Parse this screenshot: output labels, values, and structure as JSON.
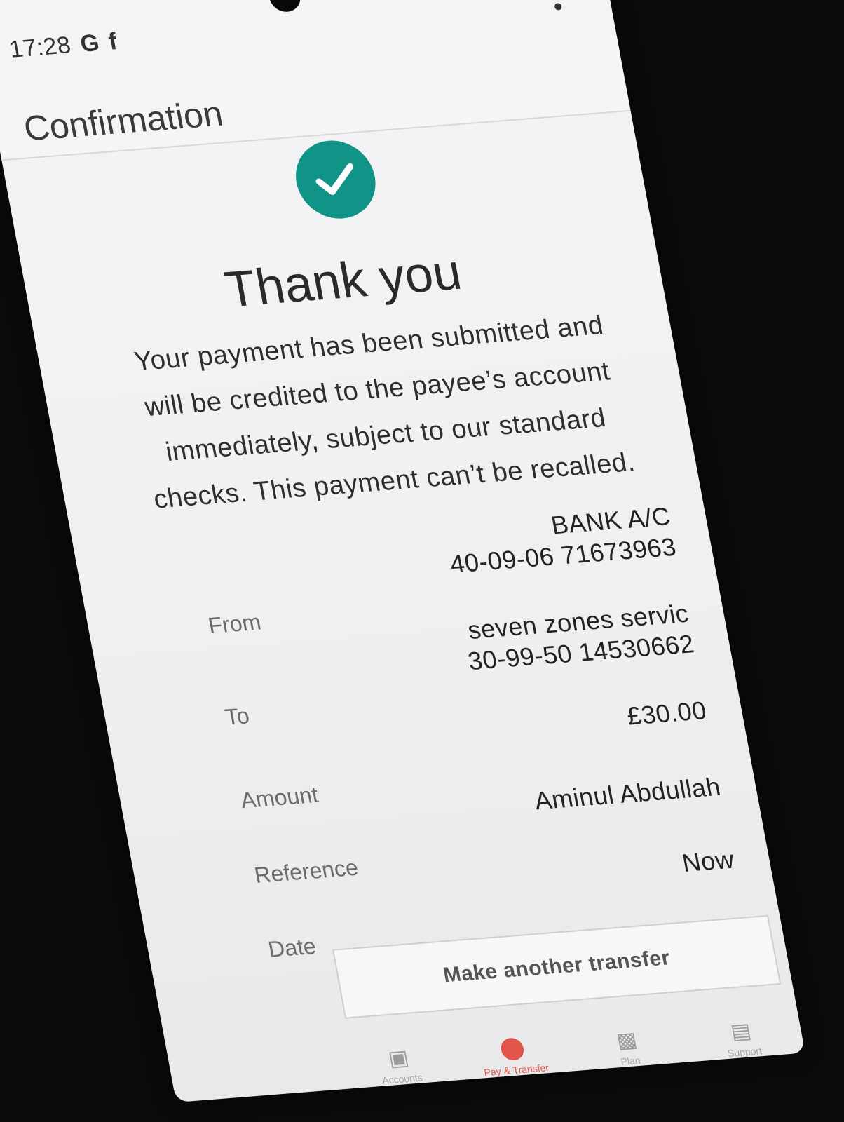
{
  "status_bar": {
    "time": "17:28",
    "icons": [
      "G",
      "f"
    ]
  },
  "header": {
    "title": "Confirmation",
    "menu_icon": "more-vertical-icon"
  },
  "success": {
    "icon": "check-circle-icon",
    "color": "#0f9487",
    "heading": "Thank you",
    "message": "Your payment has been submitted and will be credited to the payee’s account immediately, subject to our standard checks. This payment can’t be recalled."
  },
  "details": {
    "from": {
      "label": "From",
      "line1": "BANK A/C",
      "line2": "40-09-06 71673963"
    },
    "to": {
      "label": "To",
      "line1": "seven zones servic",
      "line2": "30-99-50 14530662"
    },
    "amount": {
      "label": "Amount",
      "value": "£30.00"
    },
    "reference": {
      "label": "Reference",
      "value": "Aminul Abdullah"
    },
    "date": {
      "label": "Date",
      "value": "Now"
    }
  },
  "actions": {
    "make_another_transfer": "Make another transfer"
  },
  "bottom_nav": {
    "accent": "#e2534a",
    "items": [
      {
        "label": "Accounts",
        "icon": "wallet-icon"
      },
      {
        "label": "Pay & Transfer",
        "icon": "pay-transfer-icon"
      },
      {
        "label": "Plan",
        "icon": "bar-chart-icon"
      },
      {
        "label": "Support",
        "icon": "chat-icon"
      }
    ]
  }
}
